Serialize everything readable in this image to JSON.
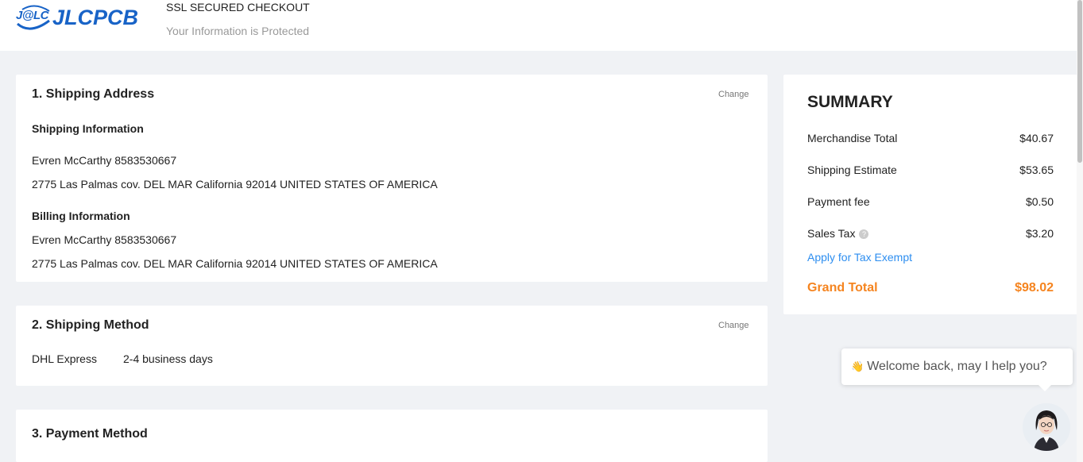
{
  "header": {
    "logo_mark": "J@LC",
    "logo_word": "JLCPCB",
    "secure_title": "SSL SECURED CHECKOUT",
    "secure_subtitle": "Your Information is Protected"
  },
  "shipping_address": {
    "title": "1. Shipping Address",
    "change_label": "Change",
    "shipping_info_title": "Shipping Information",
    "shipping_name_phone": "Evren McCarthy 8583530667",
    "shipping_address": "2775 Las Palmas cov. DEL MAR California 92014 UNITED STATES OF AMERICA",
    "billing_info_title": "Billing Information",
    "billing_name_phone": "Evren McCarthy 8583530667",
    "billing_address": "2775 Las Palmas cov. DEL MAR California 92014 UNITED STATES OF AMERICA"
  },
  "shipping_method": {
    "title": "2. Shipping Method",
    "change_label": "Change",
    "carrier": "DHL Express",
    "delivery_time": "2-4 business days"
  },
  "payment_method": {
    "title": "3. Payment Method"
  },
  "summary": {
    "title": "SUMMARY",
    "rows": [
      {
        "label": "Merchandise Total",
        "value": "$40.67"
      },
      {
        "label": "Shipping Estimate",
        "value": "$53.65"
      },
      {
        "label": "Payment fee",
        "value": "$0.50"
      },
      {
        "label": "Sales Tax",
        "value": "$3.20"
      }
    ],
    "help_glyph": "?",
    "tax_exempt_link": "Apply for Tax Exempt",
    "grand_total_label": "Grand Total",
    "grand_total_value": "$98.02",
    "accent_color": "#f5841f",
    "link_color": "#2d8ef0"
  },
  "chat": {
    "wave_emoji": "👋",
    "message": "Welcome back, may I help you?",
    "avatar_icon": "support-agent-avatar"
  }
}
